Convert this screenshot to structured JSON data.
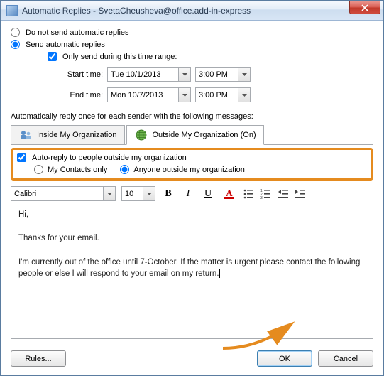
{
  "window": {
    "title": "Automatic Replies - SvetaCheusheva@office.add-in-express"
  },
  "options": {
    "do_not_send": "Do not send automatic replies",
    "send_auto": "Send automatic replies",
    "only_range": "Only send during this time range:",
    "start_label": "Start time:",
    "start_date": "Tue 10/1/2013",
    "start_time": "3:00 PM",
    "end_label": "End time:",
    "end_date": "Mon 10/7/2013",
    "end_time": "3:00 PM"
  },
  "section_label": "Automatically reply once for each sender with the following messages:",
  "tabs": {
    "inside": "Inside My Organization",
    "outside": "Outside My Organization (On)"
  },
  "outside": {
    "auto_reply": "Auto-reply to people outside my organization",
    "contacts_only": "My Contacts only",
    "anyone": "Anyone outside my organization"
  },
  "toolbar": {
    "font": "Calibri",
    "size": "10"
  },
  "message": {
    "p1": "Hi,",
    "p2": "Thanks for your email.",
    "p3": "I'm currently out of the office until 7-October. If the matter is urgent please contact the following people or else I will respond to your email on my return."
  },
  "footer": {
    "rules": "Rules...",
    "ok": "OK",
    "cancel": "Cancel"
  }
}
